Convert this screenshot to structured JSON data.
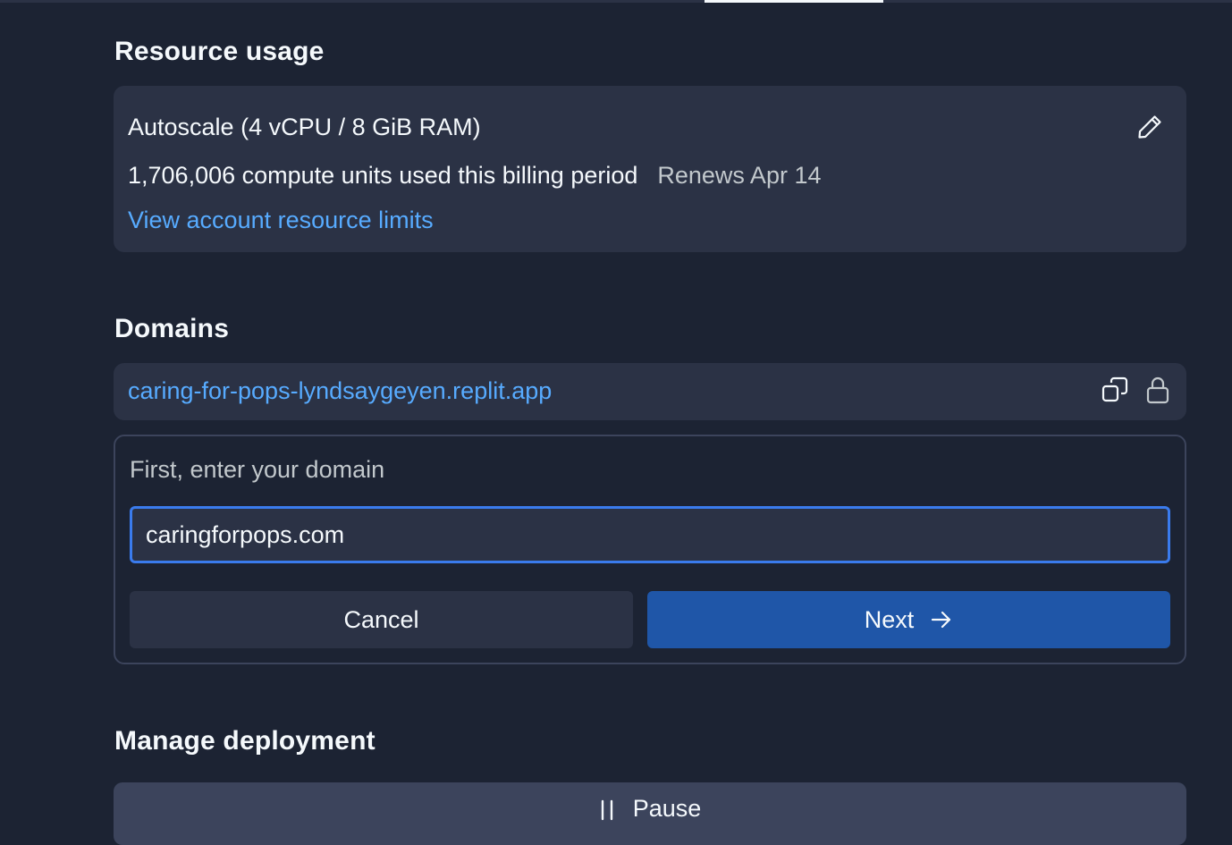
{
  "resource_usage": {
    "title": "Resource usage",
    "plan": "Autoscale (4 vCPU / 8 GiB RAM)",
    "usage": "1,706,006 compute units used this billing period",
    "renews": "Renews Apr 14",
    "limits_link": "View account resource limits",
    "edit_icon": "pencil-icon"
  },
  "domains": {
    "title": "Domains",
    "default_domain": "caring-for-pops-lyndsaygeyen.replit.app",
    "copy_icon": "copy-icon",
    "lock_icon": "lock-icon",
    "form": {
      "label": "First, enter your domain",
      "input_value": "caringforpops.com",
      "cancel_label": "Cancel",
      "next_label": "Next",
      "next_icon": "arrow-right-icon"
    }
  },
  "manage_deployment": {
    "title": "Manage deployment",
    "pause_label": "Pause",
    "pause_icon": "pause-icon"
  },
  "colors": {
    "background": "#1c2333",
    "surface": "#2b3245",
    "link": "#57abff",
    "primary": "#1f56a8",
    "focus": "#3a7bed"
  }
}
